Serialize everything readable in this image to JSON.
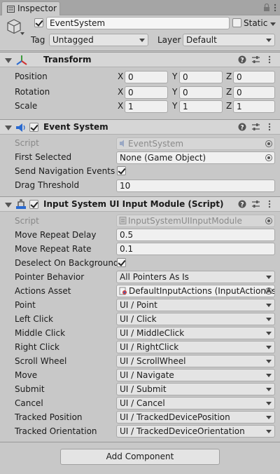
{
  "tab": {
    "title": "Inspector"
  },
  "header": {
    "name": "EventSystem",
    "active": true,
    "static_label": "Static",
    "tag_label": "Tag",
    "tag_value": "Untagged",
    "layer_label": "Layer",
    "layer_value": "Default"
  },
  "transform": {
    "title": "Transform",
    "rows": [
      {
        "label": "Position",
        "x": "0",
        "y": "0",
        "z": "0"
      },
      {
        "label": "Rotation",
        "x": "0",
        "y": "0",
        "z": "0"
      },
      {
        "label": "Scale",
        "x": "1",
        "y": "1",
        "z": "1"
      }
    ],
    "axis": {
      "x": "X",
      "y": "Y",
      "z": "Z"
    }
  },
  "event_system": {
    "title": "Event System",
    "script_label": "Script",
    "script_value": "EventSystem",
    "first_selected_label": "First Selected",
    "first_selected_value": "None (Game Object)",
    "send_nav_label": "Send Navigation Events",
    "send_nav_checked": true,
    "drag_label": "Drag Threshold",
    "drag_value": "10"
  },
  "input_module": {
    "title": "Input System UI Input Module (Script)",
    "script_label": "Script",
    "script_value": "InputSystemUIInputModule",
    "move_delay_label": "Move Repeat Delay",
    "move_delay_value": "0.5",
    "move_rate_label": "Move Repeat Rate",
    "move_rate_value": "0.1",
    "deselect_label": "Deselect On Background",
    "deselect_checked": true,
    "pointer_label": "Pointer Behavior",
    "pointer_value": "All Pointers As Is",
    "actions_label": "Actions Asset",
    "actions_value": "DefaultInputActions (InputActionAs",
    "actions": [
      {
        "label": "Point",
        "value": "UI / Point"
      },
      {
        "label": "Left Click",
        "value": "UI / Click"
      },
      {
        "label": "Middle Click",
        "value": "UI / MiddleClick"
      },
      {
        "label": "Right Click",
        "value": "UI / RightClick"
      },
      {
        "label": "Scroll Wheel",
        "value": "UI / ScrollWheel"
      },
      {
        "label": "Move",
        "value": "UI / Navigate"
      },
      {
        "label": "Submit",
        "value": "UI / Submit"
      },
      {
        "label": "Cancel",
        "value": "UI / Cancel"
      },
      {
        "label": "Tracked Position",
        "value": "UI / TrackedDevicePosition"
      },
      {
        "label": "Tracked Orientation",
        "value": "UI / TrackedDeviceOrientation"
      }
    ]
  },
  "footer": {
    "add_component": "Add Component"
  }
}
